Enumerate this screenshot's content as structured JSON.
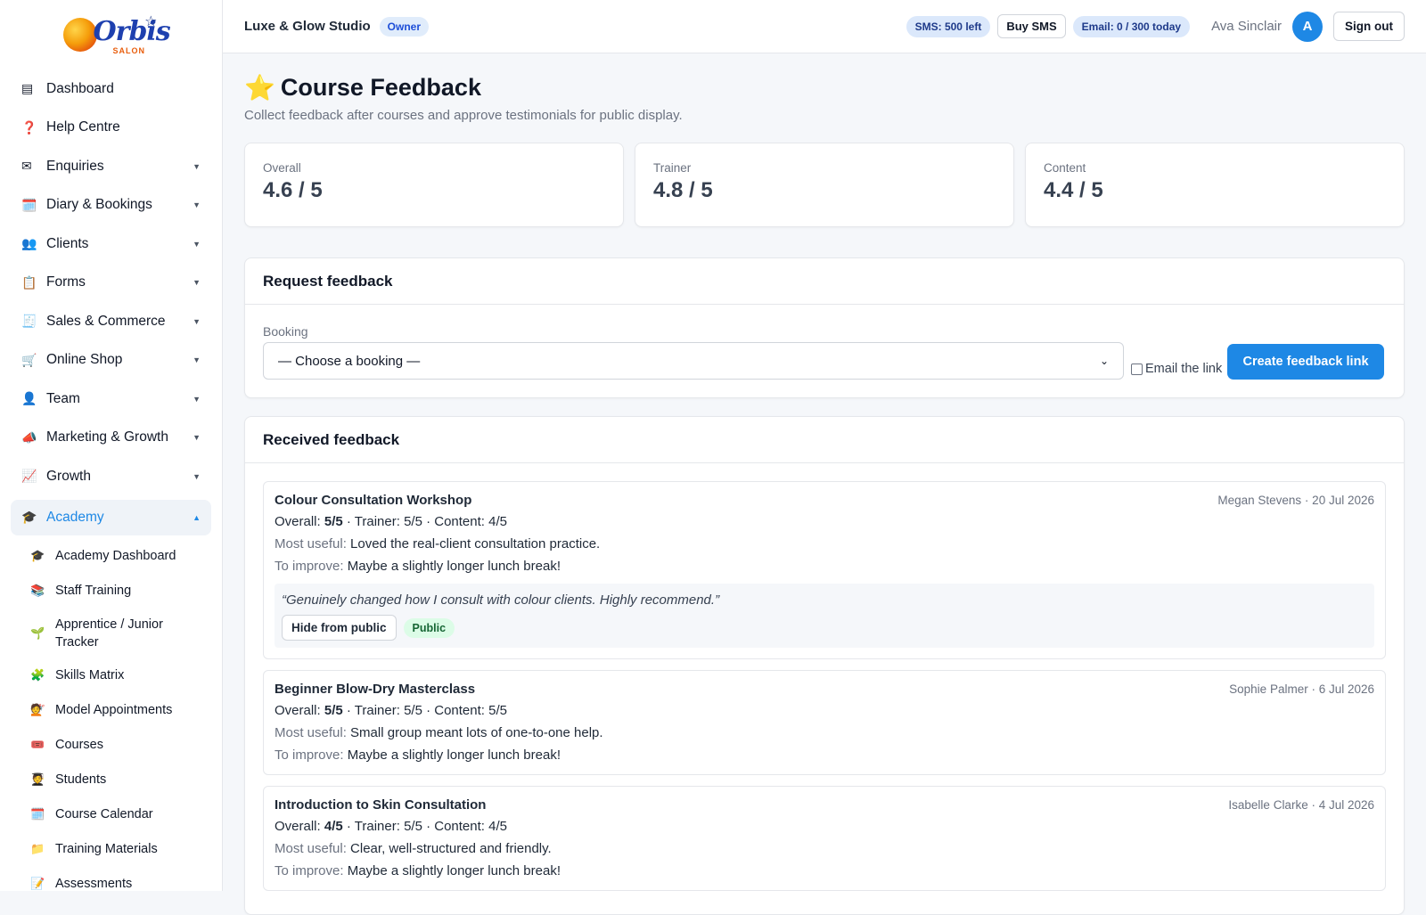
{
  "brand": {
    "logo_text": "Orbis",
    "logo_sub": "SALON"
  },
  "sidebar": {
    "items": [
      {
        "icon": "▤",
        "label": "Dashboard",
        "caret": ""
      },
      {
        "icon": "❓",
        "label": "Help Centre",
        "caret": ""
      },
      {
        "icon": "✉",
        "label": "Enquiries",
        "caret": "▼"
      },
      {
        "icon": "🗓️",
        "label": "Diary & Bookings",
        "caret": "▼"
      },
      {
        "icon": "👥",
        "label": "Clients",
        "caret": "▼"
      },
      {
        "icon": "📋",
        "label": "Forms",
        "caret": "▼"
      },
      {
        "icon": "🧾",
        "label": "Sales & Commerce",
        "caret": "▼"
      },
      {
        "icon": "🛒",
        "label": "Online Shop",
        "caret": "▼"
      },
      {
        "icon": "👤",
        "label": "Team",
        "caret": "▼"
      },
      {
        "icon": "📣",
        "label": "Marketing & Growth",
        "caret": "▼"
      },
      {
        "icon": "📈",
        "label": "Growth",
        "caret": "▼"
      }
    ],
    "active": {
      "icon": "🎓",
      "label": "Academy",
      "caret": "▲"
    },
    "sub_items": [
      {
        "icon": "🎓",
        "label": "Academy Dashboard"
      },
      {
        "icon": "📚",
        "label": "Staff Training"
      },
      {
        "icon": "🌱",
        "label": "Apprentice / Junior Tracker"
      },
      {
        "icon": "🧩",
        "label": "Skills Matrix"
      },
      {
        "icon": "💇",
        "label": "Model Appointments"
      },
      {
        "icon": "🎟️",
        "label": "Courses"
      },
      {
        "icon": "🧑‍🎓",
        "label": "Students"
      },
      {
        "icon": "🗓️",
        "label": "Course Calendar"
      },
      {
        "icon": "📁",
        "label": "Training Materials"
      },
      {
        "icon": "📝",
        "label": "Assessments"
      }
    ]
  },
  "topbar": {
    "studio": "Luxe & Glow Studio",
    "role": "Owner",
    "sms": "SMS: 500 left",
    "buy_sms": "Buy SMS",
    "email": "Email: 0 / 300 today",
    "user": "Ava Sinclair",
    "avatar": "A",
    "sign_out": "Sign out"
  },
  "page": {
    "icon": "⭐",
    "title": "Course Feedback",
    "subtitle": "Collect feedback after courses and approve testimonials for public display."
  },
  "stats": [
    {
      "label": "Overall",
      "value": "4.6 / 5"
    },
    {
      "label": "Trainer",
      "value": "4.8 / 5"
    },
    {
      "label": "Content",
      "value": "4.4 / 5"
    }
  ],
  "request": {
    "title": "Request feedback",
    "booking_label": "Booking",
    "booking_value": "— Choose a booking —",
    "email_link_label": "Email the link",
    "email_link_checked": false,
    "create_button": "Create feedback link"
  },
  "received": {
    "title": "Received feedback",
    "overall_label": "Overall:",
    "most_useful_label": "Most useful:",
    "to_improve_label": "To improve:",
    "items": [
      {
        "course": "Colour Consultation Workshop",
        "meta": "Megan Stevens · 20 Jul 2026",
        "overall": "5/5",
        "rest": " · Trainer: 5/5 · Content: 4/5",
        "most_useful": "Loved the real-client consultation practice.",
        "to_improve": "Maybe a slightly longer lunch break!",
        "quote": "“Genuinely changed how I consult with colour clients. Highly recommend.”",
        "hide_button": "Hide from public",
        "status": "Public"
      },
      {
        "course": "Beginner Blow-Dry Masterclass",
        "meta": "Sophie Palmer · 6 Jul 2026",
        "overall": "5/5",
        "rest": " · Trainer: 5/5 · Content: 5/5",
        "most_useful": "Small group meant lots of one-to-one help.",
        "to_improve": "Maybe a slightly longer lunch break!"
      },
      {
        "course": "Introduction to Skin Consultation",
        "meta": "Isabelle Clarke · 4 Jul 2026",
        "overall": "4/5",
        "rest": " · Trainer: 5/5 · Content: 4/5",
        "most_useful": "Clear, well-structured and friendly.",
        "to_improve": "Maybe a slightly longer lunch break!"
      }
    ]
  },
  "colors": {
    "accent": "#1e88e5",
    "public_badge": "#dcfce7"
  }
}
